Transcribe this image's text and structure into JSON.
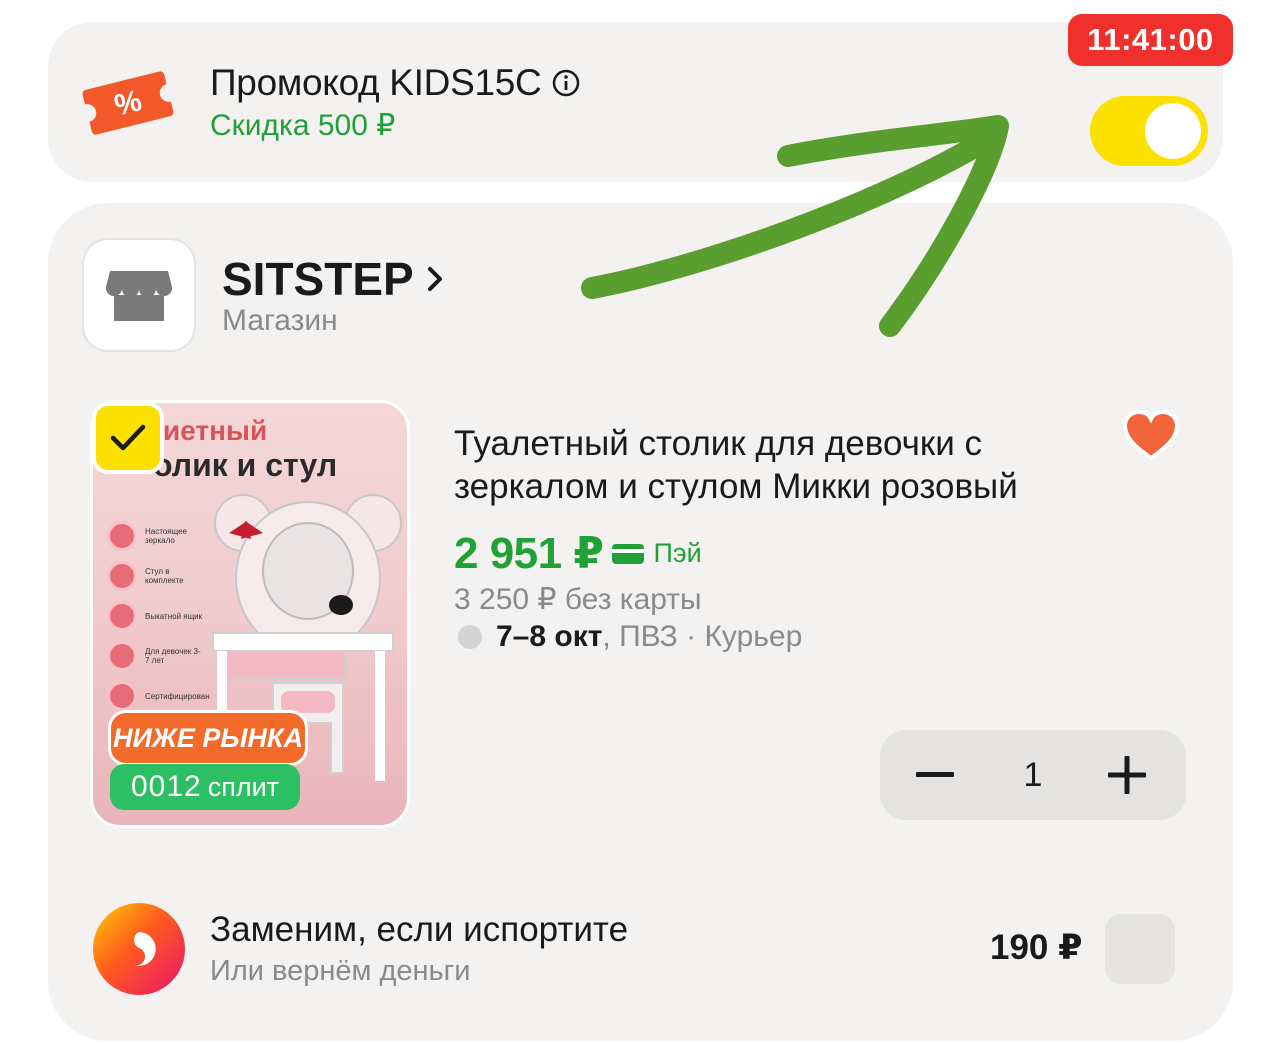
{
  "promo": {
    "title": "Промокод KIDS15C",
    "discount": "Скидка 500 ₽",
    "timer": "11:41:00",
    "toggle_on": true,
    "icon_text": "%"
  },
  "shop": {
    "name": "SITSTEP",
    "type": "Магазин"
  },
  "product": {
    "image_text_line1": "иетный",
    "image_text_line2": "олик и стул",
    "features": [
      {
        "label": "Настоящее зеркало"
      },
      {
        "label": "Стул в комплекте"
      },
      {
        "label": "Выкатной ящик"
      },
      {
        "label": "Для девочек 3-7 лет"
      },
      {
        "label": "Сертифицирован"
      }
    ],
    "badge_nizhe": "НИЖЕ РЫНКА",
    "split_number": "0012",
    "split_label": "сплит",
    "title": "Туалетный столик для девочки с зеркалом и стулом Микки розовый",
    "price": "2 951 ₽",
    "pay_label": "Пэй",
    "old_price": "3 250 ₽  без карты",
    "delivery_date": "7–8 окт",
    "delivery_methods": ", ПВЗ · Курьер",
    "quantity": "1",
    "selected": true,
    "favorite": true
  },
  "insurance": {
    "title": "Заменим, если испортите",
    "subtitle": "Или вернём деньги",
    "price": "190 ₽"
  },
  "colors": {
    "accent_yellow": "#fce000",
    "price_green": "#21a038",
    "timer_red": "#f0302c",
    "badge_orange": "#f26b2a",
    "split_green": "#2dbf64",
    "annotation_arrow": "#5a9e2f"
  }
}
